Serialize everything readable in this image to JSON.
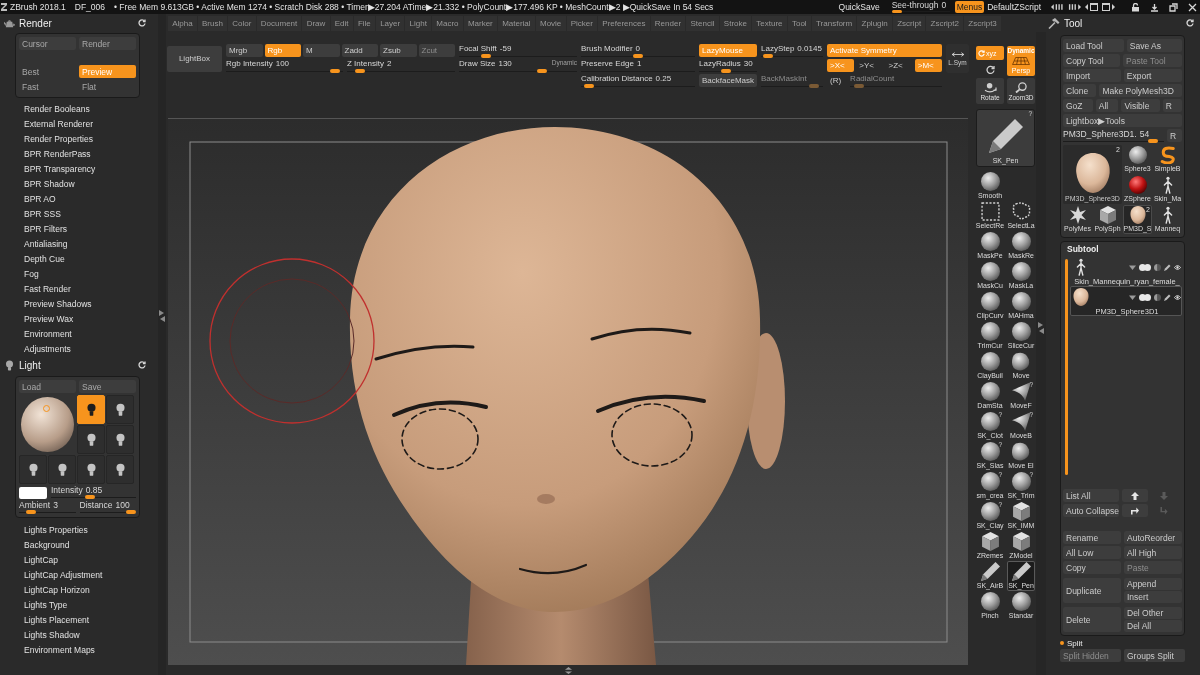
{
  "status_bar": {
    "app_title": "ZBrush 2018.1",
    "document": "DF_006",
    "stats": "• Free Mem 9.613GB • Active Mem 1274 • Scratch Disk 288 • Timer▶27.204 ATime▶21.332 • PolyCount▶177.496 KP • MeshCount▶2 ▶QuickSave In 54 Secs",
    "quicksave": "QuickSave",
    "see_through": {
      "label": "See-through",
      "reading": "0",
      "level": 0
    },
    "menus": {
      "label": "Menus",
      "on": true
    },
    "script": "DefaultZScript"
  },
  "menu_bar": [
    "Alpha",
    "Brush",
    "Color",
    "Document",
    "Draw",
    "Edit",
    "File",
    "Layer",
    "Light",
    "Macro",
    "Marker",
    "Material",
    "Movie",
    "Picker",
    "Preferences",
    "Render",
    "Stencil",
    "Stroke",
    "Texture",
    "Tool",
    "Transform",
    "Zplugin",
    "Zscript",
    "Zscript2",
    "Zscript3"
  ],
  "render_palette": {
    "title": "Render",
    "buttons": [
      "Cursor",
      "Render"
    ],
    "modes": [
      {
        "label": "Best",
        "selected": false
      },
      {
        "label": "Preview",
        "selected": true
      },
      {
        "label": "Fast",
        "selected": false
      },
      {
        "label": "Flat",
        "selected": false
      }
    ],
    "items": [
      "Render Booleans",
      "External Renderer",
      "Render Properties",
      "BPR RenderPass",
      "BPR Transparency",
      "BPR Shadow",
      "BPR AO",
      "BPR SSS",
      "BPR Filters",
      "Antialiasing",
      "Depth Cue",
      "Fog",
      "Fast Render",
      "Preview Shadows",
      "Preview Wax",
      "Environment",
      "Adjustments"
    ]
  },
  "light_palette": {
    "title": "Light",
    "buttons": [
      "Load",
      "Save"
    ],
    "lights": [
      {
        "selected": true
      },
      {
        "selected": false
      },
      {
        "selected": false
      },
      {
        "selected": false
      },
      {
        "selected": false
      },
      {
        "selected": false
      },
      {
        "selected": false
      },
      {
        "selected": false
      }
    ],
    "intensity": {
      "label": "Intensity",
      "reading": "0.85",
      "level": 0.45
    },
    "ambient": {
      "label": "Ambient",
      "reading": "3",
      "level": 0.15
    },
    "distance": {
      "label": "Distance",
      "reading": "100",
      "level": 1
    },
    "items": [
      "Lights Properties",
      "Background",
      "LightCap",
      "LightCap Adjustment",
      "LightCap Horizon",
      "Lights Type",
      "Lights Placement",
      "Lights Shadow",
      "Environment Maps"
    ]
  },
  "shelf": {
    "lightbox": "LightBox",
    "draw_modes": [
      {
        "label": "Mrgb",
        "on": false,
        "disabled": false
      },
      {
        "label": "Rgb",
        "on": true,
        "disabled": false
      },
      {
        "label": "M",
        "on": false,
        "disabled": false
      },
      {
        "label": "Zadd",
        "on": false,
        "disabled": false
      },
      {
        "label": "Zsub",
        "on": false,
        "disabled": false
      },
      {
        "label": "Zcut",
        "on": false,
        "disabled": true
      }
    ],
    "rgb_intensity": {
      "label": "Rgb Intensity",
      "reading": "100",
      "level": 0.97,
      "disabled": false
    },
    "z_intensity": {
      "label": "Z Intensity",
      "reading": "2",
      "level": 0.08,
      "disabled": false
    },
    "focal_shift": {
      "label": "Focal Shift",
      "reading": "-59",
      "level": 0.2,
      "disabled": false
    },
    "draw_size": {
      "label": "Draw Size",
      "reading": "130",
      "level": 0.72,
      "disabled": false,
      "note": "Dynamic"
    },
    "brush_modifier": {
      "label": "Brush Modifier",
      "reading": "0",
      "level": 0.5,
      "disabled": false
    },
    "preserve_edge": {
      "label": "Preserve Edge",
      "reading": "1",
      "disabled": false
    },
    "calibration_distance": {
      "label": "Calibration Distance",
      "reading": "0.25",
      "level": 0.03,
      "disabled": false
    },
    "lazy_mouse": {
      "label": "LazyMouse",
      "on": true
    },
    "lazy_step": {
      "label": "LazyStep",
      "reading": "0.0145",
      "level": 0.03,
      "disabled": false
    },
    "lazy_radius": {
      "label": "LazyRadius",
      "reading": "30",
      "level": 0.45,
      "disabled": false
    },
    "backface_mask": {
      "label": "BackfaceMask",
      "on": false
    },
    "back_mask_int": {
      "label": "BackMaskInt",
      "level": 0.92,
      "disabled": true
    },
    "activate_symmetry": {
      "label": "Activate Symmetry",
      "on": true
    },
    "axes": [
      {
        "label": ">X<",
        "on": true
      },
      {
        "label": ">Y<",
        "on": false
      },
      {
        "label": ">Z<",
        "on": false
      },
      {
        "label": ">M<",
        "on": true
      }
    ],
    "radial": {
      "label": "(R)",
      "on": false
    },
    "radial_count": {
      "label": "RadialCount",
      "level": 0.05,
      "disabled": true
    },
    "local_symmetry": {
      "label": "L.Sym",
      "on": false
    }
  },
  "view_controls": {
    "xyz": {
      "label": "xyz",
      "on": true
    },
    "persp": {
      "label": "Persp",
      "note": "Dynamic",
      "on": true
    },
    "rotate": {
      "label": "Rotate"
    },
    "zoom": {
      "label": "Zoom3D"
    }
  },
  "brush_palette": {
    "current": {
      "label": "SK_Pen",
      "badge": "?",
      "kind": "pencil"
    },
    "rows": [
      [
        {
          "label": "Smooth",
          "kind": "sphere",
          "selected": false
        }
      ],
      [
        {
          "label": "SelectRe",
          "kind": "dashed-square",
          "selected": false
        },
        {
          "label": "SelectLa",
          "kind": "lasso",
          "selected": false
        }
      ],
      [
        {
          "label": "MaskPe",
          "kind": "sphere",
          "selected": false
        },
        {
          "label": "MaskRe",
          "kind": "sphere",
          "selected": false
        }
      ],
      [
        {
          "label": "MaskCu",
          "kind": "sphere",
          "selected": false
        },
        {
          "label": "MaskLa",
          "kind": "sphere",
          "selected": false
        }
      ],
      [
        {
          "label": "ClipCurv",
          "kind": "sphere",
          "selected": false
        },
        {
          "label": "MAHma",
          "kind": "sphere",
          "selected": false
        }
      ],
      [
        {
          "label": "TrimCur",
          "kind": "sphere",
          "selected": false
        },
        {
          "label": "SliceCur",
          "kind": "sphere",
          "selected": false
        }
      ],
      [
        {
          "label": "ClayBuil",
          "kind": "sphere",
          "selected": false
        },
        {
          "label": "Move",
          "kind": "blob",
          "selected": false
        }
      ],
      [
        {
          "label": "DamSta",
          "kind": "sphere",
          "selected": false
        },
        {
          "label": "MoveF",
          "kind": "fin",
          "selected": false,
          "badge": "?"
        }
      ],
      [
        {
          "label": "SK_Clot",
          "kind": "sphere",
          "selected": false,
          "badge": "?"
        },
        {
          "label": "MoveB",
          "kind": "fin",
          "selected": false,
          "badge": "?"
        }
      ],
      [
        {
          "label": "SK_Slas",
          "kind": "sphere",
          "selected": false,
          "badge": "?"
        },
        {
          "label": "Move El",
          "kind": "blob",
          "selected": false
        }
      ],
      [
        {
          "label": "sm_crea",
          "kind": "sphere",
          "selected": false,
          "badge": "?"
        },
        {
          "label": "SK_Trim",
          "kind": "sphere",
          "selected": false,
          "badge": "?"
        }
      ],
      [
        {
          "label": "SK_Clay",
          "kind": "sphere",
          "selected": false,
          "badge": "?"
        },
        {
          "label": "SK_IMM",
          "kind": "cube",
          "selected": false
        }
      ],
      [
        {
          "label": "ZRemes",
          "kind": "cube",
          "selected": false
        },
        {
          "label": "ZModel",
          "kind": "cube",
          "selected": false
        }
      ],
      [
        {
          "label": "SK_AirB",
          "kind": "pencil",
          "selected": false
        },
        {
          "label": "SK_Pen",
          "kind": "pencil",
          "selected": true
        }
      ],
      [
        {
          "label": "Pinch",
          "kind": "sphere",
          "selected": false
        },
        {
          "label": "Standar",
          "kind": "sphere",
          "selected": false
        }
      ]
    ]
  },
  "tool_palette": {
    "title": "Tool",
    "rows": [
      [
        {
          "label": "Load Tool",
          "disabled": false
        },
        {
          "label": "Save As",
          "disabled": false
        }
      ],
      [
        {
          "label": "Copy Tool",
          "disabled": false
        },
        {
          "label": "Paste Tool",
          "disabled": true
        }
      ],
      [
        {
          "label": "Import",
          "disabled": false
        },
        {
          "label": "Export",
          "disabled": false
        }
      ],
      [
        {
          "label": "Clone",
          "disabled": false
        },
        {
          "label": "Make PolyMesh3D",
          "disabled": false
        }
      ],
      [
        {
          "label": "GoZ",
          "disabled": false
        },
        {
          "label": "All",
          "disabled": false
        },
        {
          "label": "Visible",
          "disabled": false
        },
        {
          "label": "R",
          "disabled": false
        }
      ],
      [
        {
          "label": "Lightbox▶Tools",
          "disabled": false
        }
      ]
    ],
    "active_tool": {
      "label": "PM3D_Sphere3D1.",
      "reading": "54",
      "level": 0.93
    },
    "reset": {
      "label": "R"
    },
    "current": {
      "label": "PM3D_Sphere3D",
      "count": "2",
      "kind": "head"
    },
    "tools": [
      {
        "label": "Sphere3",
        "kind": "sphere",
        "selected": false
      },
      {
        "label": "SimpleB",
        "kind": "squiggle",
        "selected": false
      },
      {
        "label": "ZSphere",
        "kind": "ball",
        "selected": false
      },
      {
        "label": "Skin_Ma",
        "kind": "figure",
        "selected": false
      },
      {
        "label": "PolyMes",
        "kind": "star",
        "selected": false
      },
      {
        "label": "PolySph",
        "kind": "cube",
        "selected": false
      },
      {
        "label": "PM3D_S",
        "kind": "head",
        "selected": true,
        "count": "2"
      },
      {
        "label": "Manneq",
        "kind": "figure",
        "selected": false
      }
    ]
  },
  "subtool": {
    "title": "Subtool",
    "items": [
      {
        "label": "Skin_Mannequin_ryan_female_",
        "kind": "figure",
        "selected": false
      },
      {
        "label": "PM3D_Sphere3D1",
        "kind": "head",
        "selected": true
      }
    ],
    "list_all": {
      "label": "List All"
    },
    "move_up": {
      "disabled": false
    },
    "move_down": {
      "disabled": true
    },
    "auto_collapse": {
      "label": "Auto Collapse"
    },
    "turn_right": {
      "disabled": false
    },
    "turn_down": {
      "disabled": true
    },
    "actions": [
      [
        {
          "label": "Rename",
          "disabled": false
        },
        {
          "label": "AutoReorder",
          "disabled": false
        }
      ],
      [
        {
          "label": "All Low",
          "disabled": false
        },
        {
          "label": "All High",
          "disabled": false
        }
      ],
      [
        {
          "label": "Copy",
          "disabled": false
        },
        {
          "label": "Paste",
          "disabled": true
        }
      ]
    ],
    "groups": [
      {
        "label": "Duplicate",
        "disabled": false,
        "options": [
          {
            "label": "Append",
            "disabled": false
          },
          {
            "label": "Insert",
            "disabled": false
          }
        ]
      },
      {
        "label": "Delete",
        "disabled": false,
        "options": [
          {
            "label": "Del Other",
            "disabled": false
          },
          {
            "label": "Del All",
            "disabled": false
          }
        ]
      }
    ]
  },
  "split": {
    "title": "Split",
    "buttons": [
      {
        "label": "Split Hidden",
        "disabled": true
      },
      {
        "label": "Groups Split",
        "disabled": false
      }
    ]
  }
}
